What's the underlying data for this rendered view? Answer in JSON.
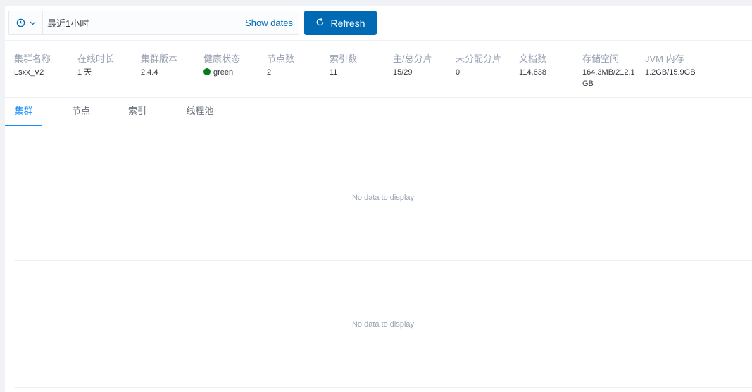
{
  "toolbar": {
    "time_range_value": "最近1小时",
    "show_dates_label": "Show dates",
    "refresh_label": "Refresh",
    "accent_color": "#006bb4"
  },
  "stats": [
    {
      "label": "集群名称",
      "value": "Lsxx_V2"
    },
    {
      "label": "在线时长",
      "value": "1 天"
    },
    {
      "label": "集群版本",
      "value": "2.4.4"
    },
    {
      "label": "健康状态",
      "value": "green",
      "status_color": "#017d1b"
    },
    {
      "label": "节点数",
      "value": "2"
    },
    {
      "label": "索引数",
      "value": "11"
    },
    {
      "label": "主/总分片",
      "value": "15/29"
    },
    {
      "label": "未分配分片",
      "value": "0"
    },
    {
      "label": "文档数",
      "value": "114,638"
    },
    {
      "label": "存储空间",
      "value": "164.3MB/212.1GB"
    },
    {
      "label": "JVM 内存",
      "value": "1.2GB/15.9GB"
    }
  ],
  "tabs": [
    {
      "label": "集群",
      "active": true
    },
    {
      "label": "节点",
      "active": false
    },
    {
      "label": "索引",
      "active": false
    },
    {
      "label": "线程池",
      "active": false
    }
  ],
  "panels": [
    {
      "message": "No data to display"
    },
    {
      "message": "No data to display"
    }
  ]
}
